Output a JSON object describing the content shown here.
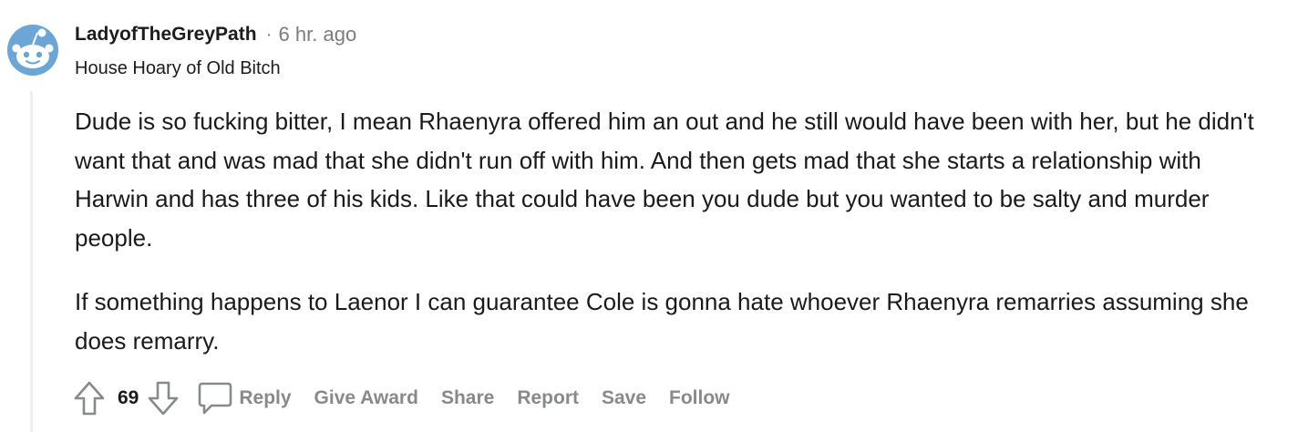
{
  "comment": {
    "author": "LadyofTheGreyPath",
    "separator": "·",
    "time": "6 hr. ago",
    "flair": "House Hoary of Old Bitch",
    "paragraphs": [
      "Dude is so fucking bitter, I mean Rhaenyra offered him an out and he still would have been with her, but he didn't want that and was mad that she didn't run off with him. And then gets mad that she starts a relationship with Harwin and has three of his kids. Like that could have been you dude but you wanted to be salty and murder people.",
      "If something happens to Laenor I can guarantee Cole is gonna hate whoever Rhaenyra remarries assuming she does remarry."
    ]
  },
  "actions": {
    "upvote_icon": "arrow-up-icon",
    "score": "69",
    "downvote_icon": "arrow-down-icon",
    "reply_icon": "speech-bubble-icon",
    "reply": "Reply",
    "give_award": "Give Award",
    "share": "Share",
    "report": "Report",
    "save": "Save",
    "follow": "Follow"
  },
  "colors": {
    "avatar_blue": "#6ba6d6",
    "muted_text": "#878a8c",
    "thread_line": "#edeff1"
  }
}
